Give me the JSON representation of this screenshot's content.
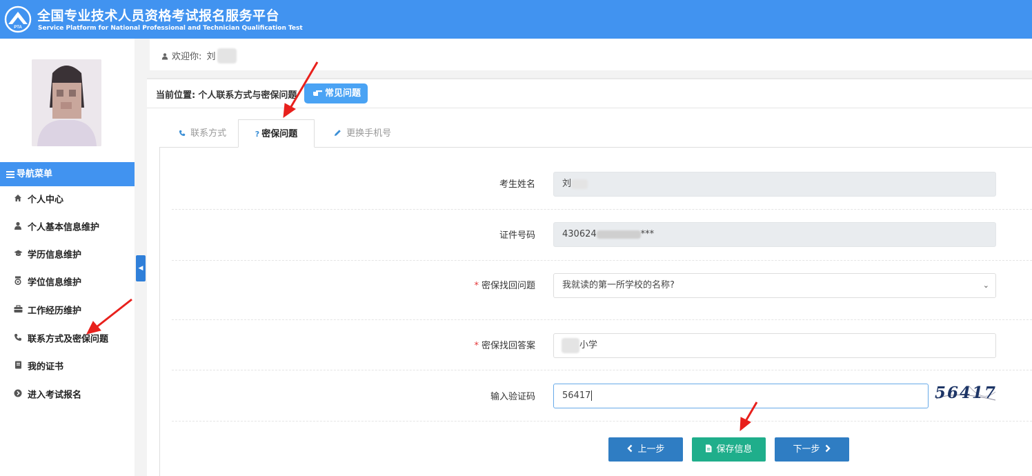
{
  "header": {
    "title_cn": "全国专业技术人员资格考试报名服务平台",
    "title_en": "Service Platform for National Professional and Technician Qualification Test",
    "logo_text": "PTA"
  },
  "sidebar": {
    "nav_title": "导航菜单",
    "items": [
      {
        "label": "个人中心",
        "icon": "home-icon"
      },
      {
        "label": "个人基本信息维护",
        "icon": "user-icon"
      },
      {
        "label": "学历信息维护",
        "icon": "graduation-cap-icon"
      },
      {
        "label": "学位信息维护",
        "icon": "medal-icon"
      },
      {
        "label": "工作经历维护",
        "icon": "briefcase-icon"
      },
      {
        "label": "联系方式及密保问题",
        "icon": "phone-icon"
      },
      {
        "label": "我的证书",
        "icon": "book-icon"
      },
      {
        "label": "进入考试报名",
        "icon": "arrow-circle-icon"
      }
    ]
  },
  "welcome": {
    "text": "欢迎你:",
    "name": "刘"
  },
  "breadcrumb": {
    "label": "当前位置:",
    "current": "个人联系方式与密保问题"
  },
  "faq_button": "常见问题",
  "tabs": [
    {
      "label": "联系方式",
      "icon": "phone-icon",
      "active": false
    },
    {
      "label": "密保问题",
      "icon": "question-icon",
      "active": true
    },
    {
      "label": "更换手机号",
      "icon": "pencil-icon",
      "active": false
    }
  ],
  "form": {
    "name_label": "考生姓名",
    "name_value": "刘",
    "id_label": "证件号码",
    "id_prefix": "430624",
    "id_suffix": "***",
    "question_label": "密保找回问题",
    "question_value": "我就读的第一所学校的名称?",
    "answer_label": "密保找回答案",
    "answer_value": "小学",
    "captcha_label": "输入验证码",
    "captcha_value": "56417",
    "captcha_image_text": "56417"
  },
  "buttons": {
    "prev": "上一步",
    "save": "保存信息",
    "next": "下一步"
  },
  "colors": {
    "brand_blue": "#4193f0",
    "button_blue": "#2f7dc3",
    "button_green": "#1fae8b",
    "required_red": "#e4393c",
    "annotation_red": "#e8201c"
  }
}
